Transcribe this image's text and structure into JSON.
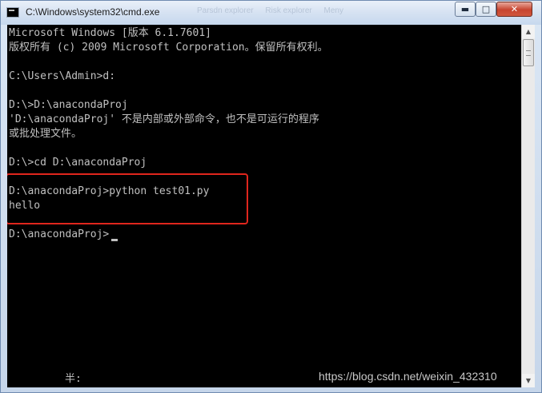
{
  "window": {
    "title": "C:\\Windows\\system32\\cmd.exe",
    "ghost_tabs": [
      "Parsdn explorer",
      "Risk explorer",
      "Meny"
    ],
    "minimize_glyph": "▬",
    "maximize_glyph": "□",
    "close_glyph": "✕"
  },
  "console": {
    "lines": [
      "Microsoft Windows [版本 6.1.7601]",
      "版权所有 (c) 2009 Microsoft Corporation。保留所有权利。",
      "",
      "C:\\Users\\Admin>d:",
      "",
      "D:\\>D:\\anacondaProj",
      "'D:\\anacondaProj' 不是内部或外部命令，也不是可运行的程序",
      "或批处理文件。",
      "",
      "D:\\>cd D:\\anacondaProj",
      "",
      "D:\\anacondaProj>python test01.py",
      "hello",
      "",
      "D:\\anacondaProj>"
    ],
    "ime_status": "半:",
    "text_color": "#c0c0c0",
    "background": "#000000"
  },
  "annotation": {
    "highlight_color": "#e0261d"
  },
  "watermark": "https://blog.csdn.net/weixin_432310",
  "scrollbar": {
    "up_icon": "▲",
    "down_icon": "▼"
  }
}
